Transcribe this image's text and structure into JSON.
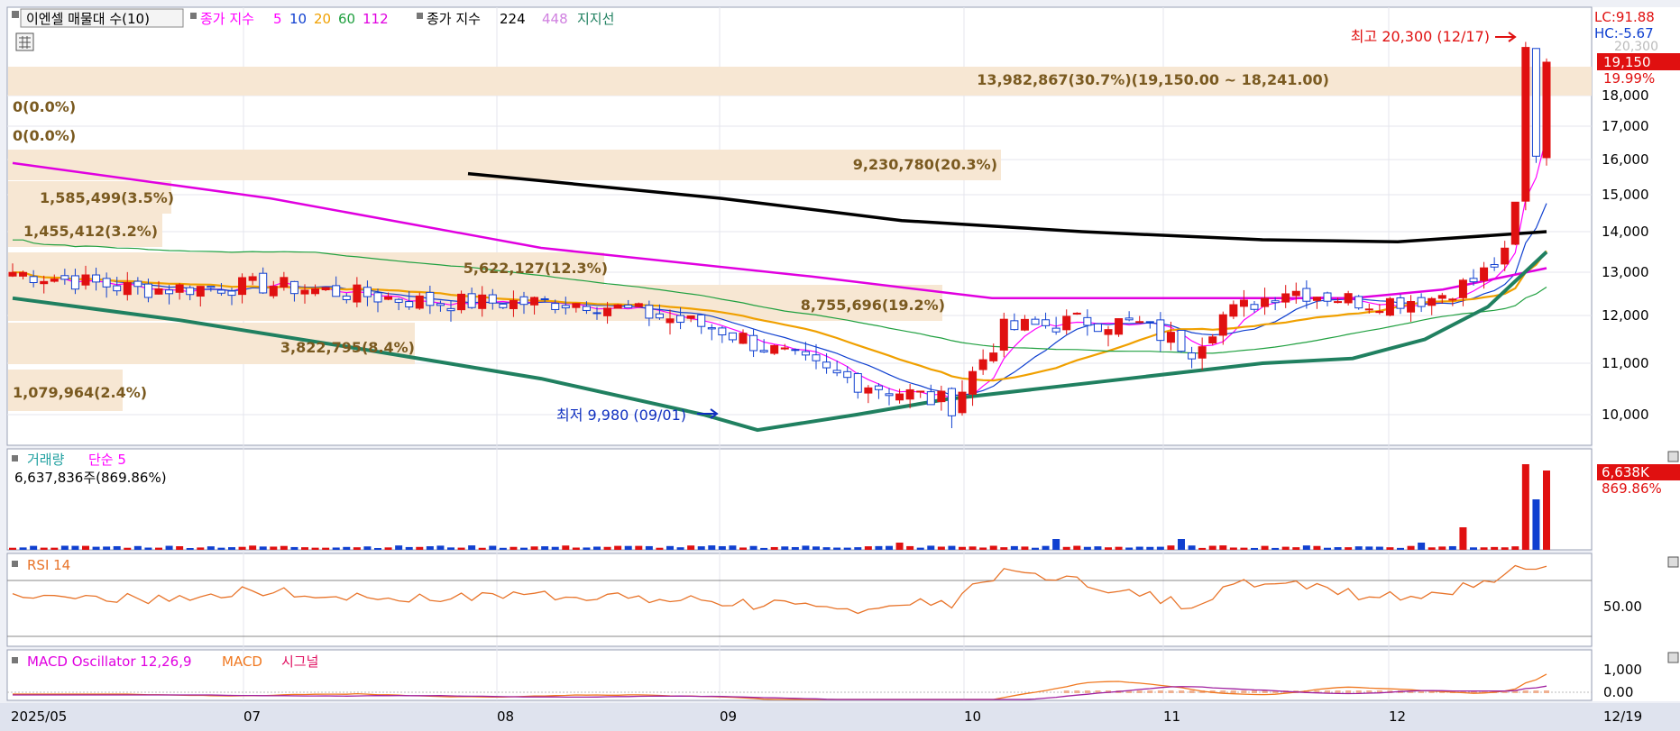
{
  "legend": {
    "toggle_label": "이엔셀 매물대 수(10)",
    "ma_prefix": "종가 지수",
    "ma_periods": [
      {
        "label": "5",
        "color": "#ff00ff"
      },
      {
        "label": "10",
        "color": "#1040d0"
      },
      {
        "label": "20",
        "color": "#f0a000"
      },
      {
        "label": "60",
        "color": "#20a040"
      },
      {
        "label": "112",
        "color": "#e000e0"
      }
    ],
    "ma_prefix2": "종가 지수",
    "ma_long": [
      {
        "label": "224",
        "color": "#000000"
      },
      {
        "label": "448",
        "color": "#d080e0"
      }
    ],
    "support_label": "지지선",
    "support_color": "#208060"
  },
  "price_axis": {
    "ticks": [
      "10,000",
      "11,000",
      "12,000",
      "13,000",
      "14,000",
      "15,000",
      "16,000",
      "17,000",
      "18,000"
    ],
    "lc_label": "LC:91.88",
    "hc_label": "HC:-5.67",
    "last_price": "19,150",
    "last_change": "19.99%",
    "top_clipped": "20,300"
  },
  "volume_profile": [
    {
      "label": "13,982,867(30.7%)(19,150.00 ~ 18,241.00)"
    },
    {
      "label": "0(0.0%)"
    },
    {
      "label": "0(0.0%)"
    },
    {
      "label": "9,230,780(20.3%)"
    },
    {
      "label": "1,585,499(3.5%)"
    },
    {
      "label": "1,455,412(3.2%)"
    },
    {
      "label": "5,622,127(12.3%)"
    },
    {
      "label": "8,755,696(19.2%)"
    },
    {
      "label": "3,822,795(8.4%)"
    },
    {
      "label": "1,079,964(2.4%)"
    }
  ],
  "annotations": {
    "high": "최고 20,300 (12/17)",
    "low": "최저 9,980 (09/01)"
  },
  "volume_panel": {
    "title": "거래량",
    "ma_label": "단순 5",
    "value_text": "6,637,836주(869.86%)",
    "last_label": "6,638K",
    "last_pct": "869.86%"
  },
  "rsi_panel": {
    "title": "RSI 14",
    "tick": "50.00"
  },
  "macd_panel": {
    "title": "MACD Oscillator 12,26,9",
    "macd_label": "MACD",
    "signal_label": "시그널",
    "ticks": [
      "1,000",
      "0.00"
    ]
  },
  "date_axis": {
    "labels": [
      "2025/05",
      "07",
      "08",
      "09",
      "10",
      "11",
      "12"
    ],
    "last_date": "12/19"
  },
  "chart_data": {
    "type": "candlestick",
    "y_range": [
      9500,
      20400
    ],
    "moving_average_periods": [
      5,
      10,
      20,
      60,
      112,
      224
    ],
    "volume_profile": [
      {
        "price_from": 18241,
        "price_to": 19150,
        "volume": 13982867,
        "pct": 30.7
      },
      {
        "volume": 0,
        "pct": 0.0
      },
      {
        "volume": 0,
        "pct": 0.0
      },
      {
        "volume": 9230780,
        "pct": 20.3
      },
      {
        "volume": 1585499,
        "pct": 3.5
      },
      {
        "volume": 1455412,
        "pct": 3.2
      },
      {
        "volume": 5622127,
        "pct": 12.3
      },
      {
        "volume": 8755696,
        "pct": 19.2
      },
      {
        "volume": 3822795,
        "pct": 8.4
      },
      {
        "volume": 1079964,
        "pct": 2.4
      }
    ],
    "high": {
      "date": "12/17",
      "price": 20300
    },
    "low": {
      "date": "09/01",
      "price": 9980
    },
    "last": {
      "date": "12/19",
      "close": 19150,
      "change_pct": 19.99,
      "volume": 6637836,
      "volume_change_pct": 869.86
    },
    "rsi_period": 14,
    "macd_params": [
      12,
      26,
      9
    ]
  }
}
